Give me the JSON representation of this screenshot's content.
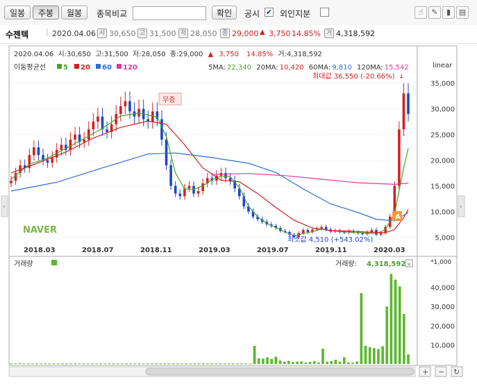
{
  "toolbar": {
    "tabs": [
      {
        "label": "일봉"
      },
      {
        "label": "주봉"
      },
      {
        "label": "월봉"
      }
    ],
    "compare_label": "종목비교",
    "compare_input_value": "",
    "confirm_label": "확인",
    "disclosure_label": "공시",
    "foreign_label": "외인지분"
  },
  "info": {
    "name": "수젠텍",
    "date": "2020.04.06",
    "open": "30,650",
    "high": "31,500",
    "low": "28,050",
    "close": "29,000",
    "change": "3,750",
    "change_pct": "14.85%",
    "volume": "4,318,592"
  },
  "header": {
    "line1": {
      "date": "2020.04.06",
      "open_label": "시:",
      "open": "30,650",
      "high_label": "고:",
      "high": "31,500",
      "low_label": "저:",
      "low": "28,050",
      "close_label": "종:",
      "close": "29,000",
      "change": "3,750",
      "change_pct": "14.85%",
      "volume_label": "거:",
      "volume": "4,318,592"
    },
    "legend_title": "이동평균선",
    "ma_legend": [
      {
        "label": "5",
        "color": "#4aa12a"
      },
      {
        "label": "20",
        "color": "#d42020"
      },
      {
        "label": "60",
        "color": "#2c6fd6"
      },
      {
        "label": "120",
        "color": "#e0389c"
      }
    ],
    "ma_values": [
      {
        "label": "5MA:",
        "value": "22,340",
        "color": "#4aa12a"
      },
      {
        "label": "20MA:",
        "value": "10,420",
        "color": "#d42020"
      },
      {
        "label": "60MA:",
        "value": "9,810",
        "color": "#2c6fd6"
      },
      {
        "label": "120MA:",
        "value": "15,542",
        "color": "#e0389c"
      }
    ],
    "scale_label": "linear",
    "max_label": "최대값 36,550 (-20.66%)",
    "min_label": "최소값 4,510 (+543.02%)",
    "watermark": "NAVER",
    "bonus_label": "무증"
  },
  "chart_data": [
    {
      "type": "candlestick",
      "title": "",
      "x": [
        "2018.03",
        "2018.07",
        "2018.11",
        "2019.03",
        "2019.07",
        "2019.11",
        "2020.03"
      ],
      "ylim": [
        2500,
        38000
      ],
      "yticks": [
        5000,
        10000,
        15000,
        20000,
        25000,
        30000,
        35000
      ],
      "ytick_labels": [
        "5,000",
        "10,000",
        "15,000",
        "20,000",
        "25,000",
        "30,000",
        "35,000"
      ],
      "scale": "linear",
      "close_series": [
        16000,
        17500,
        19000,
        18500,
        21000,
        22500,
        21000,
        20000,
        19500,
        20500,
        22000,
        23000,
        22000,
        24000,
        25000,
        23500,
        24000,
        26000,
        27500,
        28500,
        26000,
        25500,
        27000,
        29000,
        30500,
        31500,
        29500,
        28500,
        30000,
        28000,
        27500,
        29500,
        28000,
        24000,
        19000,
        15000,
        13500,
        13000,
        14500,
        15000,
        13500,
        14000,
        15500,
        16500,
        16000,
        17000,
        17500,
        16500,
        16000,
        14500,
        13000,
        11000,
        10000,
        9000,
        8500,
        8000,
        7500,
        7200,
        6800,
        6200,
        6000,
        5500,
        5000,
        5800,
        6400,
        6000,
        6500,
        6700,
        7000,
        6500,
        6100,
        6300,
        6000,
        5900,
        6200,
        6000,
        5800,
        5600,
        6000,
        6400,
        5500,
        5800,
        7000,
        9000,
        15000,
        26000,
        33000,
        29000
      ],
      "ma": [
        {
          "name": "5",
          "color": "#4aa12a",
          "values": [
            [
              0,
              16300
            ],
            [
              4,
              19200
            ],
            [
              8,
              20400
            ],
            [
              12,
              22300
            ],
            [
              16,
              24200
            ],
            [
              20,
              26200
            ],
            [
              24,
              28600
            ],
            [
              28,
              29200
            ],
            [
              32,
              28400
            ],
            [
              34,
              24600
            ],
            [
              36,
              17500
            ],
            [
              38,
              14400
            ],
            [
              40,
              14300
            ],
            [
              42,
              15000
            ],
            [
              44,
              16200
            ],
            [
              46,
              16900
            ],
            [
              48,
              16800
            ],
            [
              50,
              14700
            ],
            [
              52,
              11000
            ],
            [
              54,
              9000
            ],
            [
              56,
              7700
            ],
            [
              58,
              6900
            ],
            [
              60,
              6000
            ],
            [
              62,
              5300
            ],
            [
              64,
              5700
            ],
            [
              66,
              6100
            ],
            [
              68,
              6600
            ],
            [
              70,
              6300
            ],
            [
              72,
              6100
            ],
            [
              74,
              6000
            ],
            [
              76,
              5900
            ],
            [
              78,
              5800
            ],
            [
              80,
              5700
            ],
            [
              82,
              6500
            ],
            [
              84,
              9600
            ],
            [
              86,
              18500
            ],
            [
              87,
              22340
            ]
          ]
        },
        {
          "name": "20",
          "color": "#d42020",
          "values": [
            [
              0,
              17500
            ],
            [
              6,
              19500
            ],
            [
              12,
              21600
            ],
            [
              18,
              24300
            ],
            [
              24,
              26400
            ],
            [
              30,
              27600
            ],
            [
              34,
              27000
            ],
            [
              38,
              23000
            ],
            [
              42,
              18500
            ],
            [
              46,
              16100
            ],
            [
              50,
              15800
            ],
            [
              54,
              13500
            ],
            [
              58,
              10800
            ],
            [
              62,
              8300
            ],
            [
              66,
              6800
            ],
            [
              70,
              6300
            ],
            [
              74,
              6200
            ],
            [
              78,
              6000
            ],
            [
              82,
              5900
            ],
            [
              84,
              6500
            ],
            [
              86,
              8800
            ],
            [
              87,
              10420
            ]
          ]
        },
        {
          "name": "60",
          "color": "#2c6fd6",
          "values": [
            [
              0,
              14000
            ],
            [
              10,
              15700
            ],
            [
              20,
              18500
            ],
            [
              30,
              21200
            ],
            [
              36,
              21400
            ],
            [
              44,
              20500
            ],
            [
              52,
              19400
            ],
            [
              58,
              17600
            ],
            [
              64,
              14400
            ],
            [
              70,
              11500
            ],
            [
              76,
              9800
            ],
            [
              80,
              8500
            ],
            [
              84,
              8200
            ],
            [
              87,
              9810
            ]
          ]
        },
        {
          "name": "120",
          "color": "#e0389c",
          "values": [
            [
              44,
              17200
            ],
            [
              52,
              17400
            ],
            [
              60,
              17000
            ],
            [
              68,
              16300
            ],
            [
              76,
              15600
            ],
            [
              84,
              15300
            ],
            [
              87,
              15542
            ]
          ]
        }
      ],
      "max": {
        "label": "최대값 36,550 (-20.66%)",
        "value": 36550
      },
      "min": {
        "label": "최소값 4,510 (+543.02%)",
        "value": 4510
      }
    },
    {
      "type": "bar",
      "title": "거래량",
      "unit": "*1,000",
      "ylim": [
        0,
        50000
      ],
      "yticks": [
        10000,
        20000,
        30000,
        40000
      ],
      "ytick_labels": [
        "10,000",
        "20,000",
        "30,000",
        "40,000"
      ],
      "current_label": "거래량:",
      "current_value": "4,318,592",
      "values": [
        300,
        300,
        400,
        300,
        300,
        300,
        300,
        300,
        300,
        300,
        300,
        300,
        300,
        300,
        300,
        300,
        300,
        300,
        300,
        300,
        300,
        300,
        300,
        300,
        300,
        300,
        300,
        300,
        300,
        300,
        300,
        300,
        300,
        300,
        300,
        300,
        300,
        300,
        300,
        300,
        300,
        300,
        300,
        300,
        300,
        300,
        300,
        300,
        300,
        300,
        300,
        300,
        300,
        300,
        300,
        300,
        300,
        9500,
        3000,
        2800,
        3500,
        2600,
        3800,
        1800,
        1200,
        1600,
        1000,
        1200,
        1300,
        700,
        1100,
        1500,
        800,
        8000,
        1200,
        1500,
        2200,
        1200,
        3500,
        800,
        700,
        1300,
        37000,
        9500,
        8700,
        8300,
        7800,
        9300,
        30000,
        47000,
        44000,
        40500,
        26000,
        5000
      ]
    }
  ],
  "bottom": {
    "plus_label": "+",
    "minus_label": "−",
    "refresh_label": "↻"
  }
}
